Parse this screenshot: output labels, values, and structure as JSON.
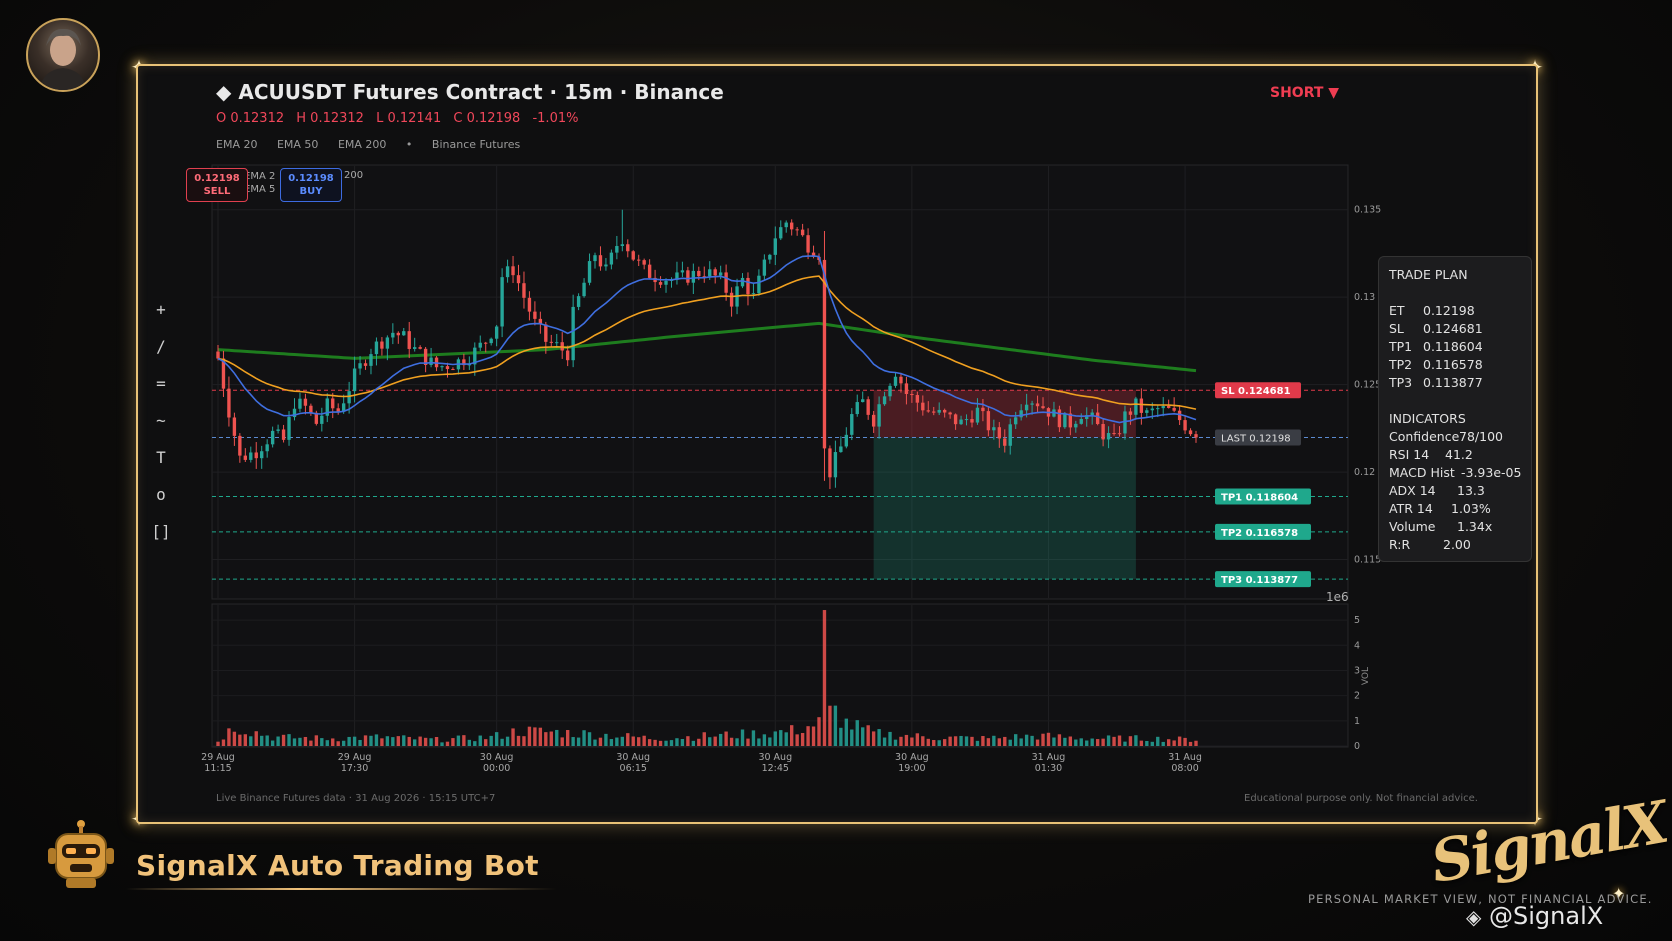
{
  "header": {
    "title": "◆  ACUUSDT Futures Contract  ·  15m  ·  Binance",
    "ohlc": [
      "O 0.12312",
      "H 0.12312",
      "L 0.12141",
      "C 0.12198",
      "-1.01%"
    ],
    "legend": [
      "EMA 20",
      "EMA 50",
      "EMA 200",
      "•",
      "Binance Futures"
    ],
    "direction": "SHORT ▼"
  },
  "quote": {
    "sell_price": "0.12198",
    "sell_label": "SELL",
    "buy_price": "0.12198",
    "buy_label": "BUY",
    "hidden_legend": [
      "EMA 2",
      "EMA 5",
      "A 200"
    ]
  },
  "tools": [
    "+",
    "/",
    "=",
    "~",
    "T",
    "o",
    "[]"
  ],
  "trade_plan": {
    "title": "TRADE PLAN",
    "levels": [
      {
        "k": "ET",
        "v": "0.12198"
      },
      {
        "k": "SL",
        "v": "0.124681"
      },
      {
        "k": "TP1",
        "v": "0.118604"
      },
      {
        "k": "TP2",
        "v": "0.116578"
      },
      {
        "k": "TP3",
        "v": "0.113877"
      }
    ],
    "indicators_title": "INDICATORS",
    "indicators": [
      {
        "k": "Confidence",
        "v": "78/100"
      },
      {
        "k": "RSI 14",
        "v": "41.2"
      },
      {
        "k": "MACD Hist",
        "v": "-3.93e-05"
      },
      {
        "k": "ADX 14",
        "v": "13.3"
      },
      {
        "k": "ATR 14",
        "v": "1.03%"
      },
      {
        "k": "Volume",
        "v": "1.34x"
      },
      {
        "k": "R:R",
        "v": "2.00"
      }
    ]
  },
  "footer": {
    "left": "Live Binance Futures data  ·  31 Aug 2026 · 15:15 UTC+7",
    "right": "Educational purpose only. Not financial advice."
  },
  "branding": {
    "bot_name": "SignalX Auto Trading Bot",
    "logo_text": "SignalX",
    "disclaimer": "PERSONAL MARKET VIEW, NOT FINANCIAL ADVICE.",
    "handle": "@SignalX"
  },
  "colors": {
    "up": "#26a69a",
    "down": "#ef5350",
    "ema20": "#3f6fe0",
    "ema50": "#f0a020",
    "ema200": "#1e7d1e",
    "sl": "#e03a4a",
    "tp": "#1fa88c",
    "last": "#5b8ad0",
    "gold": "#e8c277"
  },
  "chart_data": {
    "type": "candlestick",
    "price_axis": {
      "ticks": [
        0.135,
        0.13,
        0.125,
        0.12,
        0.115
      ],
      "tick_labels": [
        "0.135",
        "0.13",
        "0.125",
        "0.12",
        "0.115"
      ],
      "ylim": [
        0.1128,
        0.1375
      ]
    },
    "volume_axis": {
      "label": "VOL",
      "ticks": [
        0,
        1,
        2,
        3,
        4,
        5
      ],
      "multiplier": "1e6",
      "ylim": [
        0,
        5.6
      ]
    },
    "x_ticks": [
      {
        "bar": 0,
        "date": "29 Aug",
        "time": "11:15"
      },
      {
        "bar": 25,
        "date": "29 Aug",
        "time": "17:30"
      },
      {
        "bar": 51,
        "date": "30 Aug",
        "time": "00:00"
      },
      {
        "bar": 76,
        "date": "30 Aug",
        "time": "06:15"
      },
      {
        "bar": 102,
        "date": "30 Aug",
        "time": "12:45"
      },
      {
        "bar": 127,
        "date": "30 Aug",
        "time": "19:00"
      },
      {
        "bar": 152,
        "date": "31 Aug",
        "time": "01:30"
      },
      {
        "bar": 177,
        "date": "31 Aug",
        "time": "08:00"
      }
    ],
    "levels": [
      {
        "name": "SL",
        "value": 0.124681
      },
      {
        "name": "LAST",
        "value": 0.12198
      },
      {
        "name": "TP1",
        "value": 0.118604
      },
      {
        "name": "TP2",
        "value": 0.116578
      },
      {
        "name": "TP3",
        "value": 0.113877
      }
    ],
    "level_labels": [
      "SL  0.124681",
      "LAST  0.12198",
      "TP1  0.118604",
      "TP2  0.116578",
      "TP3  0.113877"
    ],
    "zone_bars": [
      120,
      168
    ],
    "close_anchors": [
      [
        0,
        0.1265
      ],
      [
        2,
        0.1235
      ],
      [
        4,
        0.1208
      ],
      [
        7,
        0.1212
      ],
      [
        10,
        0.1222
      ],
      [
        12,
        0.1218
      ],
      [
        14,
        0.124
      ],
      [
        16,
        0.1237
      ],
      [
        18,
        0.1228
      ],
      [
        20,
        0.1238
      ],
      [
        22,
        0.1235
      ],
      [
        25,
        0.1255
      ],
      [
        28,
        0.127
      ],
      [
        30,
        0.1275
      ],
      [
        32,
        0.128
      ],
      [
        34,
        0.1277
      ],
      [
        36,
        0.127
      ],
      [
        38,
        0.1265
      ],
      [
        40,
        0.126
      ],
      [
        43,
        0.1262
      ],
      [
        46,
        0.1266
      ],
      [
        49,
        0.1275
      ],
      [
        51,
        0.1285
      ],
      [
        52,
        0.1312
      ],
      [
        54,
        0.1316
      ],
      [
        56,
        0.13
      ],
      [
        58,
        0.1285
      ],
      [
        60,
        0.1275
      ],
      [
        62,
        0.1272
      ],
      [
        64,
        0.1268
      ],
      [
        65,
        0.129
      ],
      [
        67,
        0.1308
      ],
      [
        69,
        0.1325
      ],
      [
        71,
        0.1315
      ],
      [
        73,
        0.133
      ],
      [
        74,
        0.1334
      ],
      [
        76,
        0.1323
      ],
      [
        78,
        0.1315
      ],
      [
        80,
        0.1312
      ],
      [
        83,
        0.131
      ],
      [
        86,
        0.1312
      ],
      [
        89,
        0.1315
      ],
      [
        92,
        0.131
      ],
      [
        94,
        0.1298
      ],
      [
        96,
        0.131
      ],
      [
        98,
        0.13
      ],
      [
        100,
        0.1318
      ],
      [
        102,
        0.1335
      ],
      [
        104,
        0.1343
      ],
      [
        106,
        0.1338
      ],
      [
        108,
        0.133
      ],
      [
        110,
        0.1325
      ],
      [
        111,
        0.1212
      ],
      [
        112,
        0.12
      ],
      [
        114,
        0.1214
      ],
      [
        116,
        0.1232
      ],
      [
        118,
        0.124
      ],
      [
        120,
        0.123
      ],
      [
        122,
        0.1247
      ],
      [
        124,
        0.1258
      ],
      [
        126,
        0.1245
      ],
      [
        128,
        0.124
      ],
      [
        130,
        0.1235
      ],
      [
        133,
        0.1232
      ],
      [
        136,
        0.1228
      ],
      [
        139,
        0.1235
      ],
      [
        142,
        0.1222
      ],
      [
        144,
        0.1218
      ],
      [
        146,
        0.1235
      ],
      [
        148,
        0.1243
      ],
      [
        150,
        0.124
      ],
      [
        152,
        0.1235
      ],
      [
        154,
        0.123
      ],
      [
        156,
        0.1228
      ],
      [
        158,
        0.1234
      ],
      [
        160,
        0.123
      ],
      [
        162,
        0.1222
      ],
      [
        164,
        0.1218
      ],
      [
        166,
        0.1232
      ],
      [
        168,
        0.1238
      ],
      [
        170,
        0.1233
      ],
      [
        172,
        0.1236
      ],
      [
        174,
        0.1235
      ],
      [
        176,
        0.123
      ],
      [
        178,
        0.1224
      ],
      [
        179,
        0.12198
      ]
    ],
    "volume_anchors": [
      [
        0,
        0.2
      ],
      [
        3,
        0.8
      ],
      [
        10,
        0.35
      ],
      [
        20,
        0.3
      ],
      [
        30,
        0.35
      ],
      [
        40,
        0.25
      ],
      [
        50,
        0.35
      ],
      [
        55,
        0.6
      ],
      [
        62,
        0.55
      ],
      [
        70,
        0.45
      ],
      [
        80,
        0.3
      ],
      [
        90,
        0.4
      ],
      [
        100,
        0.5
      ],
      [
        105,
        0.6
      ],
      [
        110,
        0.9
      ],
      [
        111,
        5.4
      ],
      [
        112,
        1.6
      ],
      [
        115,
        0.9
      ],
      [
        120,
        0.5
      ],
      [
        130,
        0.35
      ],
      [
        140,
        0.3
      ],
      [
        150,
        0.4
      ],
      [
        160,
        0.3
      ],
      [
        170,
        0.3
      ],
      [
        179,
        0.25
      ]
    ],
    "ema200_anchors": [
      [
        0,
        0.127
      ],
      [
        25,
        0.1265
      ],
      [
        60,
        0.127
      ],
      [
        85,
        0.1278
      ],
      [
        110,
        0.1285
      ],
      [
        130,
        0.1276
      ],
      [
        160,
        0.1264
      ],
      [
        179,
        0.1258
      ]
    ],
    "bar_count": 180
  }
}
